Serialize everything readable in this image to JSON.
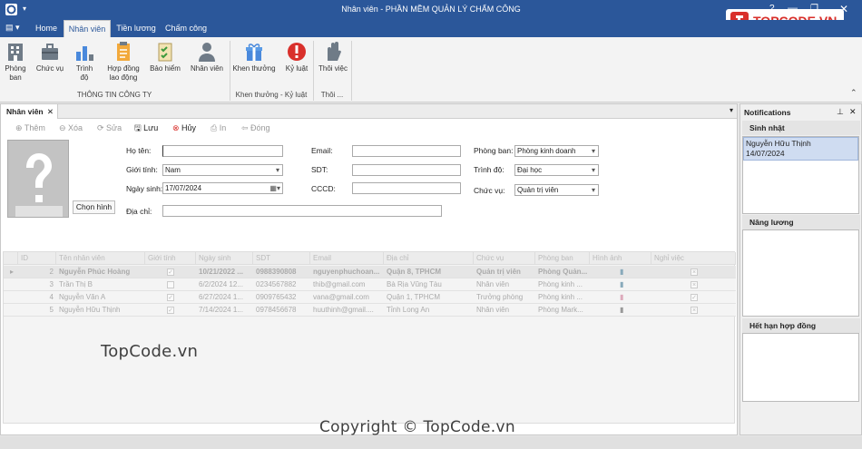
{
  "title": "Nhân viên - PHẦN MỀM QUẢN LÝ CHẤM CÔNG",
  "logo_text": "TOPCODE.VN",
  "tabs": [
    "Home",
    "Nhân viên",
    "Tiền lương",
    "Chấm công"
  ],
  "ribbon": {
    "buttons": [
      {
        "label": "Phòng\nban",
        "icon": "building-icon"
      },
      {
        "label": "Chức vụ",
        "icon": "briefcase-icon"
      },
      {
        "label": "Trình\nđộ",
        "icon": "bar-chart-icon"
      },
      {
        "label": "Hợp đồng\nlao động",
        "icon": "contract-icon"
      },
      {
        "label": "Bảo hiểm",
        "icon": "checklist-icon"
      },
      {
        "label": "Nhân viên",
        "icon": "person-icon"
      },
      {
        "label": "Khen thưởng",
        "icon": "gift-icon"
      },
      {
        "label": "Kỷ luật",
        "icon": "warning-icon"
      },
      {
        "label": "Thôi việc",
        "icon": "hand-icon"
      }
    ],
    "groups": [
      "THÔNG TIN CÔNG TY",
      "Khen thưởng - Kỷ luật",
      "Thôi ..."
    ]
  },
  "doc_tab": "Nhân viên",
  "toolbar": {
    "add": "Thêm",
    "delete": "Xóa",
    "edit": "Sửa",
    "save": "Lưu",
    "cancel": "Hủy",
    "print": "In",
    "close": "Đóng"
  },
  "form": {
    "choose_image": "Chọn hình",
    "name_label": "Họ tên:",
    "name_value": "",
    "gender_label": "Giới tính:",
    "gender_value": "Nam",
    "dob_label": "Ngày sinh:",
    "dob_value": "17/07/2024",
    "address_label": "Địa chỉ:",
    "address_value": "",
    "email_label": "Email:",
    "email_value": "",
    "phone_label": "SDT:",
    "phone_value": "",
    "cccd_label": "CCCD:",
    "cccd_value": "",
    "dept_label": "Phòng ban:",
    "dept_value": "Phòng kinh doanh",
    "level_label": "Trình độ:",
    "level_value": "Đại học",
    "position_label": "Chức vụ:",
    "position_value": "Quản trị viên"
  },
  "grid": {
    "columns": [
      "ID",
      "Tên nhân viên",
      "Giới tính",
      "Ngày sinh",
      "SDT",
      "Email",
      "Địa chỉ",
      "Chức vụ",
      "Phòng ban",
      "Hình ảnh",
      "Nghỉ việc"
    ],
    "rows": [
      {
        "id": "2",
        "name": "Nguyễn Phúc Hoàng",
        "male": true,
        "dob": "10/21/2022 ...",
        "phone": "0988390808",
        "email": "nguyenphuchoan...",
        "address": "Quận 8, TPHCM",
        "position": "Quản trị viên",
        "dept": "Phòng Quản...",
        "quit": false
      },
      {
        "id": "3",
        "name": "Trần Thị B",
        "male": false,
        "dob": "6/2/2024 12...",
        "phone": "0234567882",
        "email": "thib@gmail.com",
        "address": "Bà Rịa Vũng Tàu",
        "position": "Nhân viên",
        "dept": "Phòng kinh ...",
        "quit": false
      },
      {
        "id": "4",
        "name": "Nguyễn Văn A",
        "male": true,
        "dob": "6/27/2024 1...",
        "phone": "0909765432",
        "email": "vana@gmail.com",
        "address": "Quận 1, TPHCM",
        "position": "Trưởng phòng",
        "dept": "Phòng kinh ...",
        "quit": true
      },
      {
        "id": "5",
        "name": "Nguyễn Hữu Thịnh",
        "male": true,
        "dob": "7/14/2024 1...",
        "phone": "0978456678",
        "email": "huuthinh@gmail....",
        "address": "Tỉnh Long An",
        "position": "Nhân viên",
        "dept": "Phòng Mark...",
        "quit": false
      }
    ]
  },
  "notifications": {
    "title": "Notifications",
    "birthday_header": "Sinh nhật",
    "birthday_items": [
      {
        "name": "Nguyễn Hữu Thịnh",
        "date": "14/07/2024"
      }
    ],
    "raise_header": "Nâng lương",
    "contract_header": "Hết hạn hợp đồng"
  },
  "watermarks": {
    "left": "TopCode.vn",
    "bottom": "Copyright © TopCode.vn"
  },
  "colors": {
    "titlebar": "#2b579a",
    "accent_red": "#d9302b",
    "selection": "#cfdcf1"
  }
}
